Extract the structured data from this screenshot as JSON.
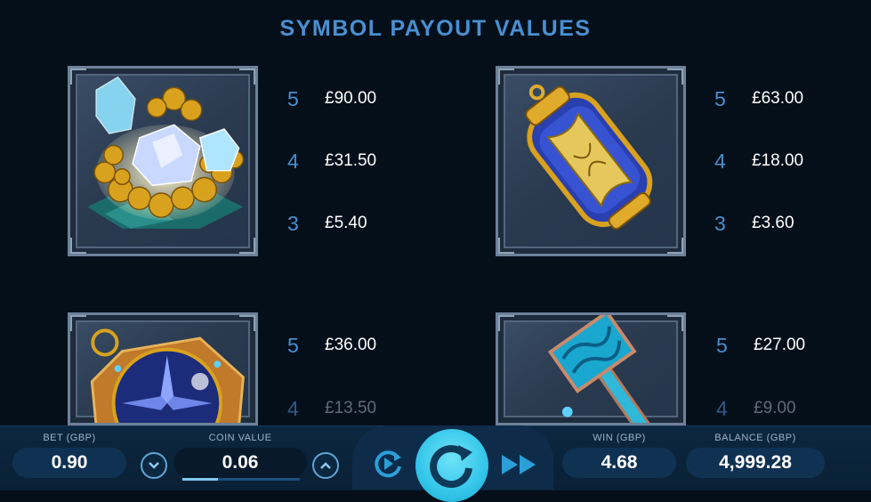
{
  "title": "SYMBOL PAYOUT VALUES",
  "symbols": [
    {
      "name": "crystals-and-gold",
      "payouts": [
        {
          "count": "5",
          "value": "£90.00"
        },
        {
          "count": "4",
          "value": "£31.50"
        },
        {
          "count": "3",
          "value": "£5.40"
        }
      ]
    },
    {
      "name": "scroll-capsule",
      "payouts": [
        {
          "count": "5",
          "value": "£63.00"
        },
        {
          "count": "4",
          "value": "£18.00"
        },
        {
          "count": "3",
          "value": "£3.60"
        }
      ]
    },
    {
      "name": "compass",
      "payouts": [
        {
          "count": "5",
          "value": "£36.00"
        },
        {
          "count": "4",
          "value": "£13.50"
        }
      ]
    },
    {
      "name": "hammer",
      "payouts": [
        {
          "count": "5",
          "value": "£27.00"
        },
        {
          "count": "4",
          "value": "£9.00"
        }
      ]
    }
  ],
  "bottom_bar": {
    "bet_label": "BET (GBP)",
    "bet_value": "0.90",
    "coin_label": "COIN VALUE",
    "coin_value": "0.06",
    "coin_level": 0.3,
    "win_label": "WIN (GBP)",
    "win_value": "4.68",
    "balance_label": "BALANCE (GBP)",
    "balance_value": "4,999.28"
  },
  "icons": {
    "decrease": "chevron-down-icon",
    "increase": "chevron-up-icon",
    "autoplay": "autoplay-icon",
    "spin": "spin-icon",
    "turbo": "fast-forward-icon"
  },
  "colors": {
    "background": "#050f1a",
    "accent_blue": "#4a8fd0",
    "spin_button": "#34c6ea"
  }
}
